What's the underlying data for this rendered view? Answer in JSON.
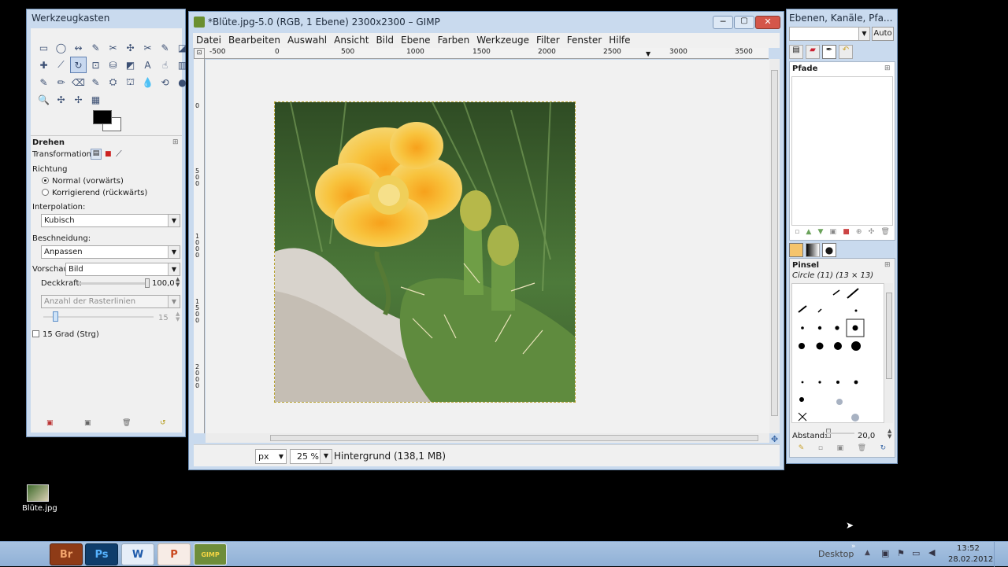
{
  "toolbox": {
    "title": "Werkzeugkasten",
    "tools": [
      "▭",
      "◯",
      "↭",
      "✎",
      "✂",
      "✣",
      "✂",
      "✎",
      "◪",
      "✚",
      "⟋",
      "↻",
      "⊡",
      "⛁",
      "◩",
      "A",
      "☝",
      "▥",
      "✎",
      "✏",
      "⌫",
      "✎",
      "⛭",
      "⛫",
      "💧",
      "⟲",
      "●",
      "🔍",
      "✣",
      "✢",
      "▦"
    ],
    "section_title": "Drehen",
    "transform_label": "Transformation:",
    "direction_label": "Richtung",
    "direction_normal": "Normal (vorwärts)",
    "direction_corrective": "Korrigierend (rückwärts)",
    "interpolation_label": "Interpolation:",
    "interpolation_value": "Kubisch",
    "clipping_label": "Beschneidung:",
    "clipping_value": "Anpassen",
    "preview_label": "Vorschau:",
    "preview_value": "Bild",
    "opacity_label": "Deckkraft:",
    "opacity_value": "100,0",
    "grid_lines": "Anzahl der Rasterlinien",
    "grid_value": "15",
    "snap_label": "15 Grad (Strg)"
  },
  "image_window": {
    "title": "*Blüte.jpg-5.0 (RGB, 1 Ebene) 2300x2300 – GIMP",
    "menu": [
      "Datei",
      "Bearbeiten",
      "Auswahl",
      "Ansicht",
      "Bild",
      "Ebene",
      "Farben",
      "Werkzeuge",
      "Filter",
      "Fenster",
      "Hilfe"
    ],
    "ruler_h": [
      "-500",
      "0",
      "500",
      "1000",
      "1500",
      "2000",
      "2500",
      "3000",
      "3500"
    ],
    "ruler_v": [
      "0",
      "5\n0\n0",
      "1\n0\n0\n0",
      "1\n5\n0\n0",
      "2\n0\n0\n0"
    ],
    "unit": "px",
    "zoom": "25 %",
    "status": "Hintergrund (138,1 MB)"
  },
  "layers": {
    "title": "Ebenen, Kanäle, Pfa...",
    "auto_label": "Auto",
    "paths_title": "Pfade",
    "brushes_title": "Pinsel",
    "brush_name": "Circle (11) (13 × 13)",
    "spacing_label": "Abstand:",
    "spacing_value": "20,0"
  },
  "desktop": {
    "file_label": "Blüte.jpg"
  },
  "taskbar": {
    "apps": [
      "Br",
      "Ps",
      "W",
      "P",
      "GIMP"
    ],
    "desktop_label": "Desktop",
    "time": "13:52",
    "date": "28.02.2012"
  }
}
